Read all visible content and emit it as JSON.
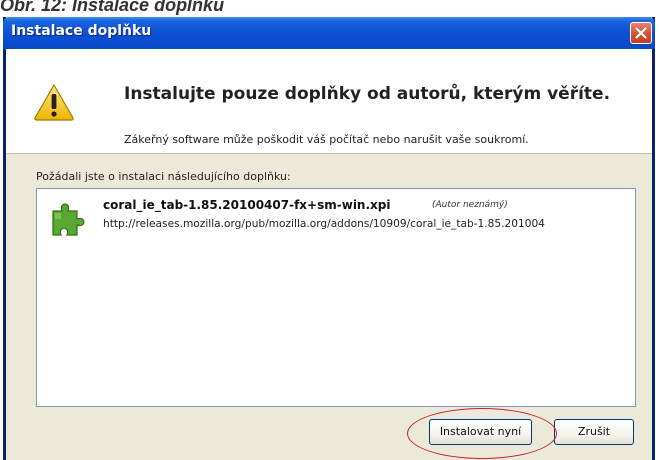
{
  "caption": "Obr. 12: Instalace doplňku",
  "window": {
    "title": "Instalace doplňku"
  },
  "warning": {
    "headline": "Instalujte pouze doplňky od autorů, kterým věříte.",
    "subline": "Zákeřný software může poškodit váš počítač nebo narušit vaše soukromí."
  },
  "request": {
    "label": "Požádali jste o instalaci následujícího doplňku:"
  },
  "addon": {
    "name": "coral_ie_tab-1.85.20100407-fx+sm-win.xpi",
    "author": "(Autor neznámý)",
    "url": "http://releases.mozilla.org/pub/mozilla.org/addons/10909/coral_ie_tab-1.85.201004"
  },
  "buttons": {
    "install": "Instalovat nyní",
    "cancel": "Zrušit"
  },
  "colors": {
    "titlebar": "#0a4fd4",
    "close": "#d7553a",
    "highlight": "#c8202a"
  }
}
